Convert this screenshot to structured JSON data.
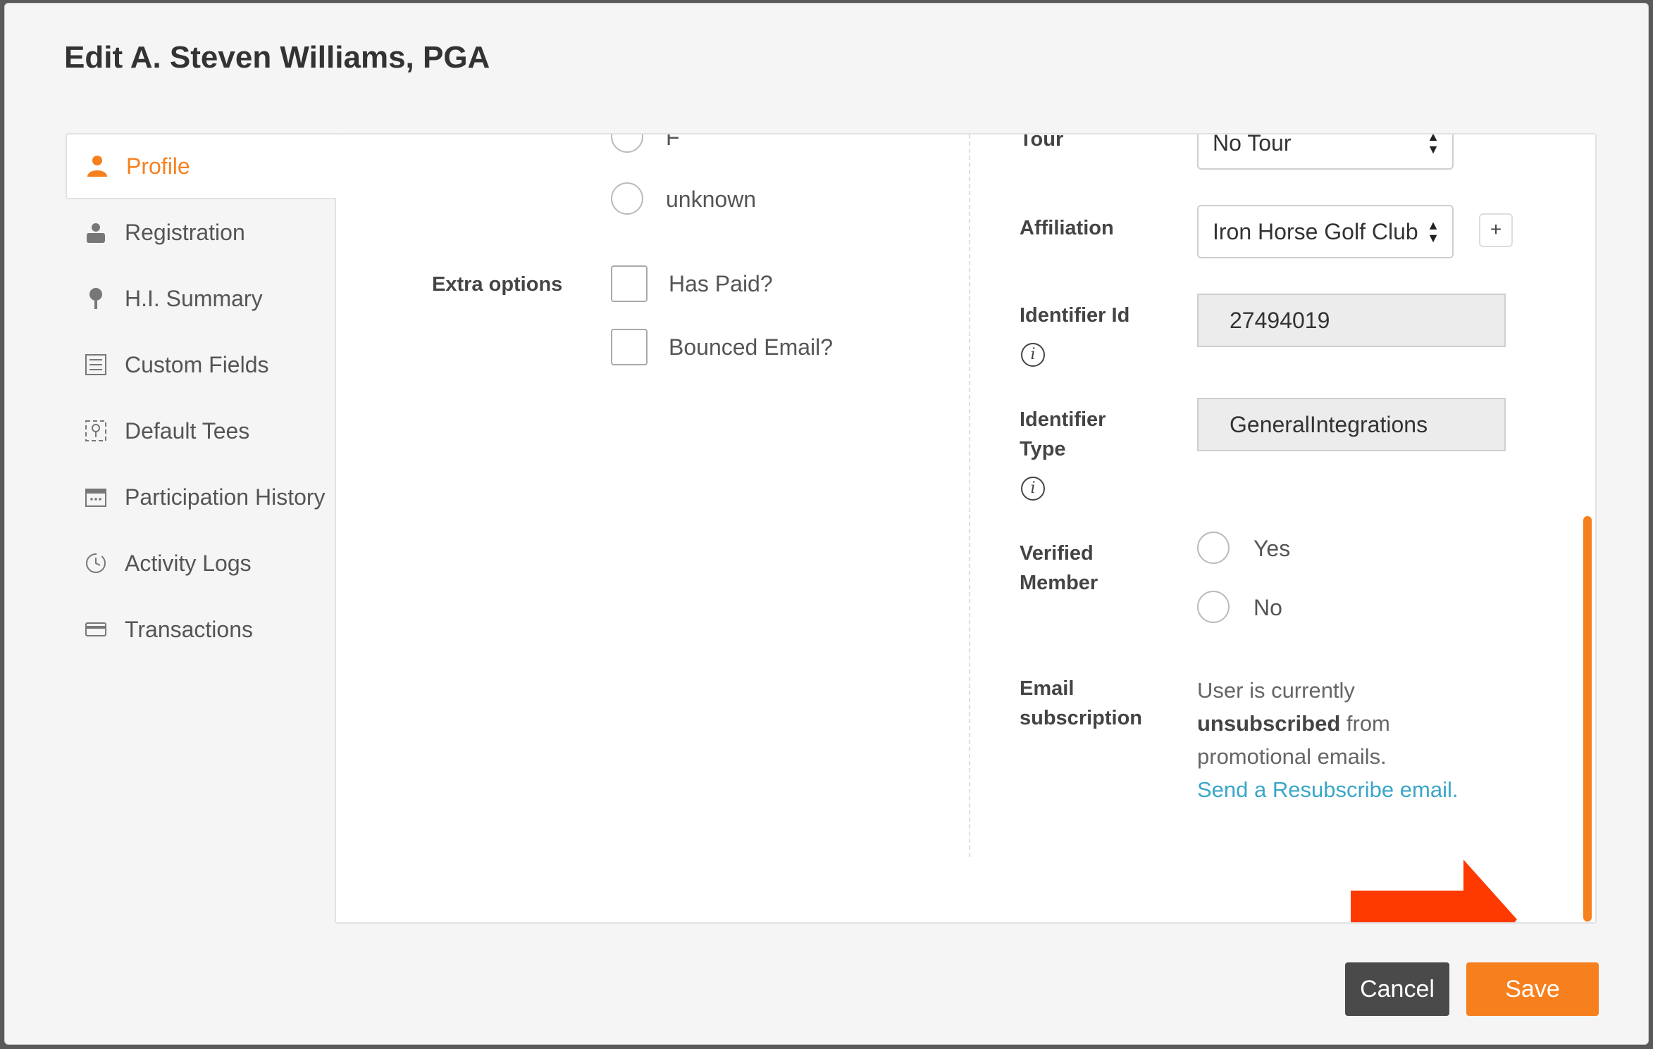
{
  "modal": {
    "title": "Edit A. Steven Williams, PGA"
  },
  "sidebar": {
    "items": [
      {
        "label": "Profile",
        "icon": "person-icon",
        "active": true
      },
      {
        "label": "Registration",
        "icon": "id-badge-icon"
      },
      {
        "label": "H.I. Summary",
        "icon": "golf-ball-tee-icon"
      },
      {
        "label": "Custom Fields",
        "icon": "list-icon"
      },
      {
        "label": "Default Tees",
        "icon": "tee-marker-icon"
      },
      {
        "label": "Participation History",
        "icon": "calendar-icon"
      },
      {
        "label": "Activity Logs",
        "icon": "clock-icon"
      },
      {
        "label": "Transactions",
        "icon": "credit-card-icon"
      }
    ]
  },
  "left": {
    "gender_options": [
      "F",
      "unknown"
    ],
    "extra_options_label": "Extra options",
    "checkboxes": [
      "Has Paid?",
      "Bounced Email?"
    ]
  },
  "right": {
    "tour": {
      "label": "Tour",
      "value": "No Tour"
    },
    "affiliation": {
      "label": "Affiliation",
      "value": "Iron Horse Golf Club",
      "add": "+"
    },
    "identifier_id": {
      "label": "Identifier Id",
      "value": "27494019",
      "info": "i"
    },
    "identifier_type": {
      "label_line1": "Identifier",
      "label_line2": "Type",
      "value": "GeneralIntegrations",
      "info": "i"
    },
    "verified": {
      "label_line1": "Verified",
      "label_line2": "Member",
      "options": [
        "Yes",
        "No"
      ]
    },
    "email": {
      "label_line1": "Email",
      "label_line2": "subscription",
      "text1": "User is currently",
      "bold": "unsubscribed",
      "text2": " from",
      "text3": "promotional emails.",
      "link": "Send a Resubscribe email."
    }
  },
  "footer": {
    "cancel": "Cancel",
    "save": "Save"
  },
  "colors": {
    "accent": "#f7801e",
    "link": "#3aa6c8",
    "arrow": "#ff3a00",
    "cancel": "#4a4a4a"
  }
}
